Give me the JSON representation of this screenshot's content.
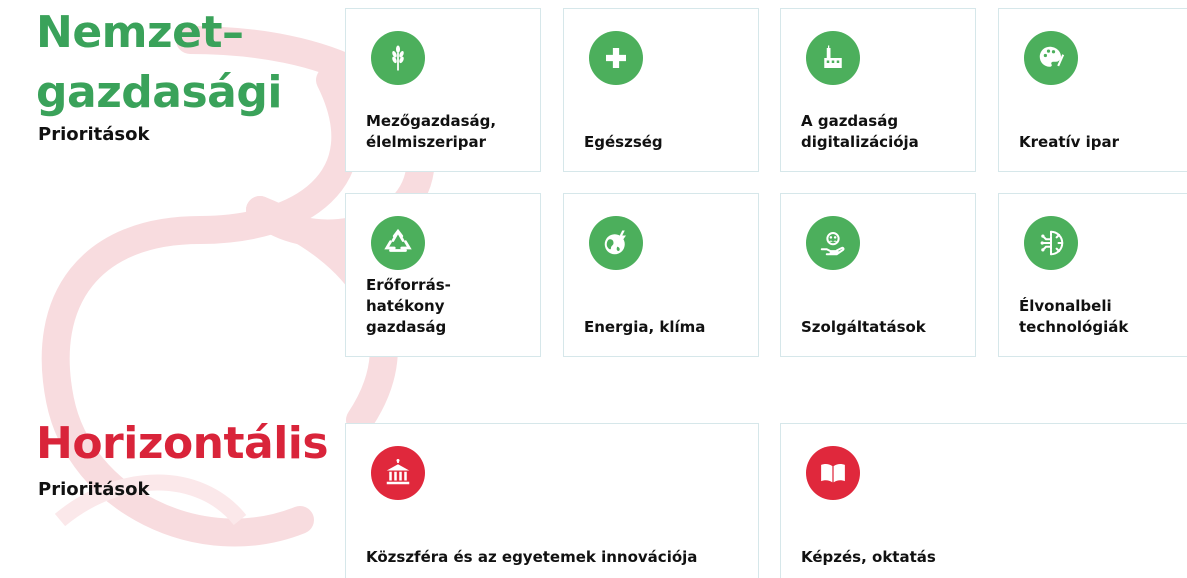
{
  "national": {
    "title_line1": "Nemzet–",
    "title_line2": "gazdasági",
    "subtitle": "Prioritások",
    "cards": [
      {
        "label": "Mezőgazdaság,\nélelmiszeripar",
        "icon": "wheat-icon"
      },
      {
        "label": "Egészség",
        "icon": "plus-icon"
      },
      {
        "label": "A gazdaság\ndigitalizációja",
        "icon": "factory-icon"
      },
      {
        "label": "Kreatív ipar",
        "icon": "palette-icon"
      },
      {
        "label": "Erőforrás-\nhatékony\ngazdaság",
        "icon": "recycle-icon"
      },
      {
        "label": "Energia, klíma",
        "icon": "globe-bolt-icon"
      },
      {
        "label": "Szolgáltatások",
        "icon": "hand-people-icon"
      },
      {
        "label": "Élvonalbeli\ntechnológiák",
        "icon": "gear-circuit-icon"
      }
    ]
  },
  "horizontal": {
    "title": "Horizontális",
    "subtitle": "Prioritások",
    "cards": [
      {
        "label": "Közszféra és az egyetemek innovációja",
        "icon": "institution-icon"
      },
      {
        "label": "Képzés, oktatás",
        "icon": "book-icon"
      }
    ]
  },
  "colors": {
    "green": "#3aa25a",
    "green_icon": "#4caf5c",
    "red": "#d9243a",
    "red_icon": "#e0283c",
    "watermark": "#f7d9dc"
  }
}
